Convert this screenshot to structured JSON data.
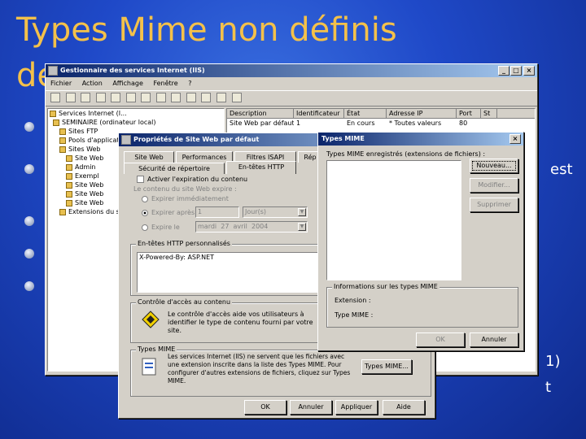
{
  "slide": {
    "title_line1": "Types Mime non définis",
    "title_line2": "de",
    "frag_est": "est",
    "frag_paren": "1)",
    "frag_t": "t"
  },
  "iis": {
    "title": "Gestionnaire des services Internet (IIS)",
    "menu": [
      "Fichier",
      "Action",
      "Affichage",
      "Fenêtre",
      "?"
    ],
    "tree": [
      "Services Internet (I...",
      "SEMINAIRE (ordinateur local)",
      "Sites FTP",
      "Pools d'applications",
      "Sites Web",
      "Site Web",
      "Admin",
      "Exempl",
      "Site Web",
      "Site Web",
      "Site Web",
      "Extensions du service Web"
    ],
    "columns": [
      "Description",
      "Identificateur",
      "État",
      "Adresse IP",
      "Port",
      "St"
    ],
    "row": [
      "Site Web par défaut",
      "1",
      "En cours",
      "* Toutes valeurs",
      "80"
    ]
  },
  "props": {
    "title": "Propriétés de Site Web par défaut",
    "tabs_row1": [
      "Site Web",
      "Performances",
      "Filtres ISAPI",
      "Rép"
    ],
    "tabs_row2": [
      "Sécurité de répertoire",
      "En-têtes HTTP"
    ],
    "expire_checkbox": "Activer l'expiration du contenu",
    "expire_caption": "Le contenu du site Web expire :",
    "radio_immediate": "Expirer immédiatement",
    "radio_after": "Expirer après",
    "radio_on": "Expire le",
    "after_value": "1",
    "after_unit": "Jour(s)",
    "date_day": "mardi",
    "date_num": "27",
    "date_month": "avril",
    "date_year": "2004",
    "headers_group": "En-têtes HTTP personnalisés",
    "header_value": "X-Powered-By: ASP.NET",
    "rating_group": "Contrôle d'accès au contenu",
    "rating_text": "Le contrôle d'accès aide vos utilisateurs à identifier le type de contenu fourni par votre site.",
    "mime_group": "Types MIME",
    "mime_text": "Les services Internet (IIS) ne servent que les fichiers avec une extension inscrite dans la liste des Types MIME. Pour configurer d'autres extensions de fichiers, cliquez sur Types MIME.",
    "mime_button": "Types MIME...",
    "ok": "OK",
    "cancel": "Annuler",
    "apply": "Appliquer",
    "help": "Aide"
  },
  "mime": {
    "title": "Types MIME",
    "list_label": "Types MIME enregistrés (extensions de fichiers) :",
    "new_button": "Nouveau...",
    "modify_button": "Modifier...",
    "delete_button": "Supprimer",
    "info_group": "Informations sur les types MIME",
    "extension_label": "Extension :",
    "type_label": "Type MIME :",
    "ok": "OK",
    "cancel": "Annuler"
  }
}
